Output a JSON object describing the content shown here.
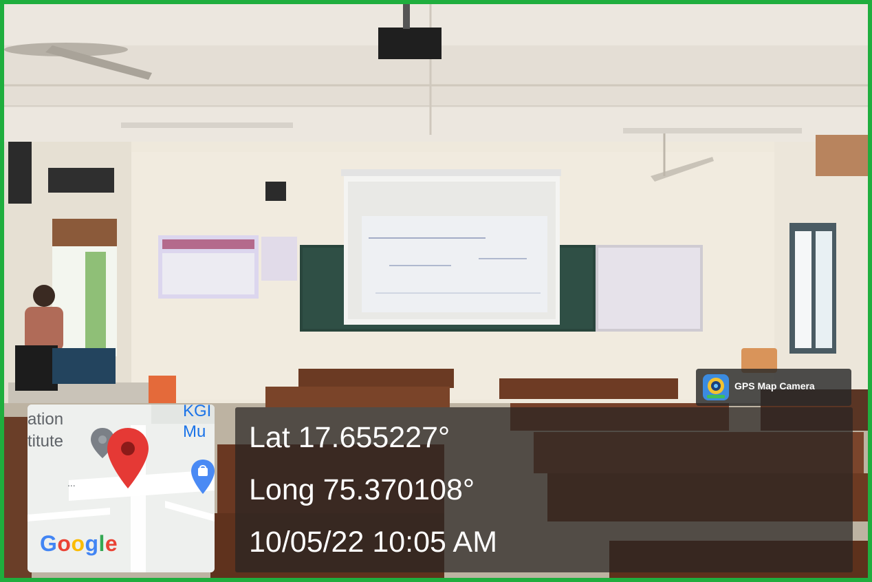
{
  "image": {
    "border_color": "#1fae3e",
    "scene": "classroom"
  },
  "gps_badge": {
    "label": "GPS Map Camera",
    "icon": "gps-map-camera-icon"
  },
  "map_tile": {
    "partial_labels": [
      "ation",
      "titute",
      "KGI",
      "Mu",
      "..."
    ],
    "logo": "Google",
    "pin_color": "#e53935",
    "icons": [
      "location-pin-icon",
      "secondary-pin-icon",
      "shopping-bag-icon"
    ]
  },
  "location_overlay": {
    "latitude": "Lat 17.655227°",
    "longitude": "Long 75.370108°",
    "timestamp": "10/05/22 10:05 AM"
  }
}
